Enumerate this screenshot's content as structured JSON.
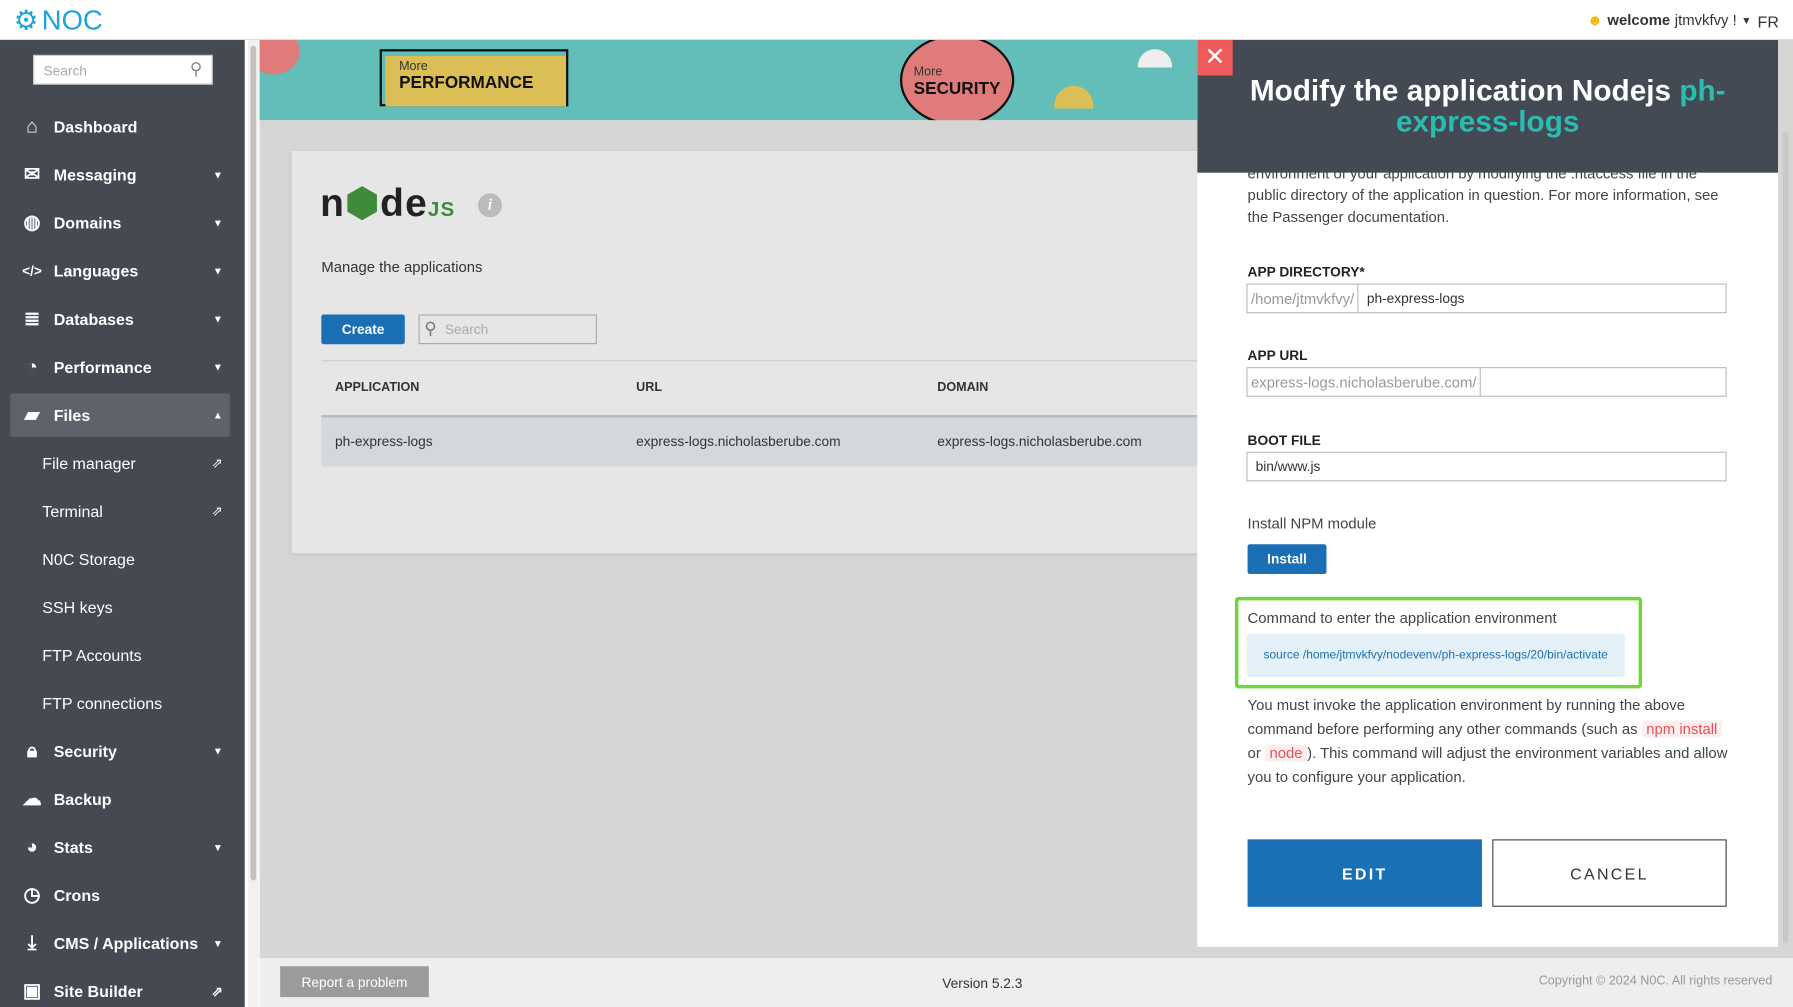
{
  "header": {
    "logo": "NOC",
    "welcome": "welcome",
    "username": "jtmvkfvy !",
    "language": "FR"
  },
  "sidebar": {
    "search_placeholder": "Search",
    "items": [
      {
        "label": "Dashboard",
        "icon": "home-icon",
        "caret": false
      },
      {
        "label": "Messaging",
        "icon": "envelope-icon",
        "caret": true
      },
      {
        "label": "Domains",
        "icon": "globe-icon",
        "caret": true
      },
      {
        "label": "Languages",
        "icon": "code-icon",
        "caret": true
      },
      {
        "label": "Databases",
        "icon": "database-icon",
        "caret": true
      },
      {
        "label": "Performance",
        "icon": "gauge-icon",
        "caret": true
      },
      {
        "label": "Files",
        "icon": "folder-icon",
        "caret": true,
        "active": true
      },
      {
        "label": "File manager",
        "sub": true,
        "external": true
      },
      {
        "label": "Terminal",
        "sub": true,
        "external": true
      },
      {
        "label": "N0C Storage",
        "sub": true
      },
      {
        "label": "SSH keys",
        "sub": true
      },
      {
        "label": "FTP Accounts",
        "sub": true
      },
      {
        "label": "FTP connections",
        "sub": true
      },
      {
        "label": "Security",
        "icon": "lock-icon",
        "caret": true
      },
      {
        "label": "Backup",
        "icon": "cloud-icon",
        "caret": false
      },
      {
        "label": "Stats",
        "icon": "pie-chart-icon",
        "caret": true
      },
      {
        "label": "Crons",
        "icon": "clock-icon",
        "caret": false
      },
      {
        "label": "CMS / Applications",
        "icon": "download-icon",
        "caret": true
      },
      {
        "label": "Site Builder",
        "icon": "image-icon",
        "external": true
      }
    ]
  },
  "banner": {
    "more1": "More",
    "perf": "PERFORMANCE",
    "more2": "More",
    "sec": "SECURITY"
  },
  "main": {
    "logo": "node js",
    "subtitle": "Manage the applications",
    "create": "Create",
    "search_placeholder": "Search",
    "columns": [
      "APPLICATION",
      "URL",
      "DOMAIN"
    ],
    "rows": [
      [
        "ph-express-logs",
        "express-logs.nicholasberube.com",
        "express-logs.nicholasberube.com"
      ]
    ]
  },
  "footer": {
    "report": "Report a problem",
    "version": "Version 5.2.3",
    "copyright": "Copyright © 2024 N0C. All rights reserved"
  },
  "panel": {
    "title": "Modify the application Nodejs",
    "app_name": "ph-express-logs",
    "intro_cut": "environment of your application by modifying the .htaccess file in the",
    "intro": "public directory of the application in question. For more information, see the Passenger documentation.",
    "app_dir_label": "APP DIRECTORY*",
    "app_dir_prefix": "/home/jtmvkfvy/",
    "app_dir_value": "ph-express-logs",
    "app_url_label": "APP URL",
    "app_url_prefix": "express-logs.nicholasberube.com/",
    "app_url_value": "",
    "boot_label": "BOOT FILE",
    "boot_value": "bin/www.js",
    "npm_label": "Install NPM module",
    "install": "Install",
    "cmd_label": "Command to enter the application environment",
    "cmd": "source /home/jtmvkfvy/nodevenv/ph-express-logs/20/bin/activate",
    "note1": "You must invoke the application environment by running the above command before performing any other commands (such as",
    "code1": "npm install",
    "note2": "or",
    "code2": "node",
    "note3": "). This command will adjust the environment variables and allow you to configure your application.",
    "edit": "EDIT",
    "cancel": "CANCEL"
  },
  "colors": {
    "accent": "#1a6fb5",
    "teal": "#2bbcb0",
    "highlight": "#6fd63a",
    "close": "#ef5b5b"
  }
}
